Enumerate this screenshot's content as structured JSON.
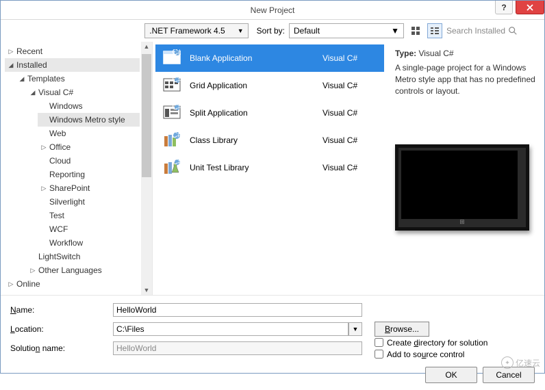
{
  "window": {
    "title": "New Project"
  },
  "toolbar": {
    "framework": ".NET Framework 4.5",
    "sortby_label": "Sort by:",
    "sortby_value": "Default",
    "search_placeholder": "Search Installed"
  },
  "sidebar": {
    "recent": "Recent",
    "installed": "Installed",
    "templates": "Templates",
    "csharp": "Visual C#",
    "items": {
      "windows": "Windows",
      "metro": "Windows Metro style",
      "web": "Web",
      "office": "Office",
      "cloud": "Cloud",
      "reporting": "Reporting",
      "sharepoint": "SharePoint",
      "silverlight": "Silverlight",
      "test": "Test",
      "wcf": "WCF",
      "workflow": "Workflow"
    },
    "lightswitch": "LightSwitch",
    "other": "Other Languages",
    "online": "Online"
  },
  "templates": [
    {
      "name": "Blank Application",
      "lang": "Visual C#"
    },
    {
      "name": "Grid Application",
      "lang": "Visual C#"
    },
    {
      "name": "Split Application",
      "lang": "Visual C#"
    },
    {
      "name": "Class Library",
      "lang": "Visual C#"
    },
    {
      "name": "Unit Test Library",
      "lang": "Visual C#"
    }
  ],
  "detail": {
    "type_label": "Type:",
    "type_value": "Visual C#",
    "description": "A single-page project for a Windows Metro style app that has no predefined controls or layout."
  },
  "form": {
    "name_label": "Name:",
    "name_value": "HelloWorld",
    "location_label": "Location:",
    "location_value": "C:\\Files",
    "browse": "Browse...",
    "solname_label": "Solution name:",
    "solname_value": "HelloWorld",
    "create_dir": "Create directory for solution",
    "add_source": "Add to source control"
  },
  "buttons": {
    "ok": "OK",
    "cancel": "Cancel"
  },
  "watermark": "亿速云"
}
